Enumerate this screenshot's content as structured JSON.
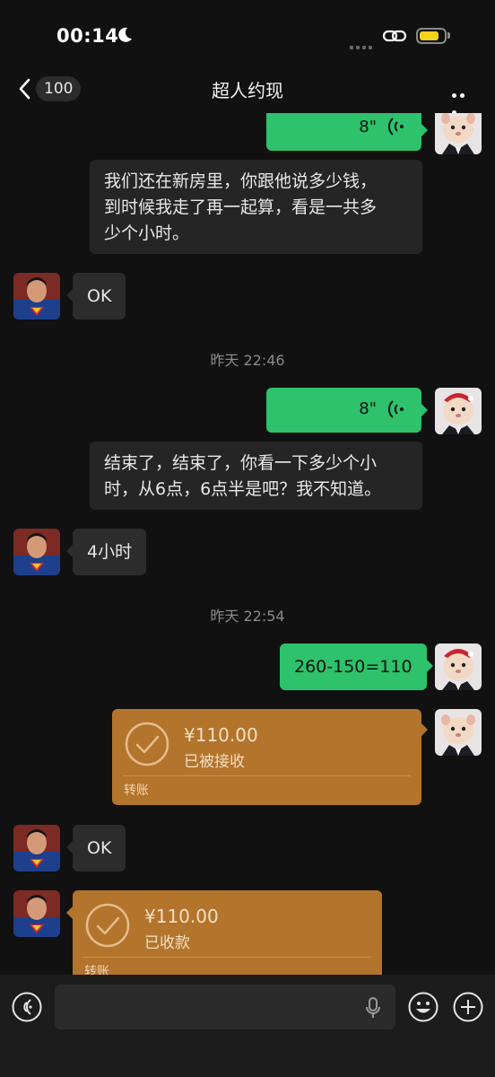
{
  "status_bar": {
    "time": "00:14",
    "battery_level": 0.7,
    "battery_color": "#f2d31b"
  },
  "nav": {
    "unread_count": "100",
    "title": "超人约现"
  },
  "messages": {
    "voice1": {
      "duration": "8\""
    },
    "transcript1": {
      "lines": [
        "我们还在新房里，你跟他说多少钱，",
        "到时候我走了再一起算，看是一共多",
        "少个小时。"
      ]
    },
    "reply1": {
      "text": "OK"
    },
    "divider1": {
      "text": "昨天 22:46"
    },
    "voice2": {
      "duration": "8\""
    },
    "transcript2": {
      "lines": [
        "结束了，结束了，你看一下多少个小",
        "时，从6点，6点半是吧？我不知道。"
      ]
    },
    "reply2": {
      "text": "4小时"
    },
    "divider2": {
      "text": "昨天 22:54"
    },
    "calc": {
      "text": "260-150=110"
    },
    "transfer_out": {
      "amount": "¥110.00",
      "status": "已被接收",
      "kind": "转账"
    },
    "reply3": {
      "text": "OK"
    },
    "transfer_in": {
      "amount": "¥110.00",
      "status": "已收款",
      "kind": "转账"
    }
  },
  "colors": {
    "sent_bubble": "#2dc26b",
    "received_bubble": "#2c2c2c",
    "transfer": "#b3742c"
  }
}
